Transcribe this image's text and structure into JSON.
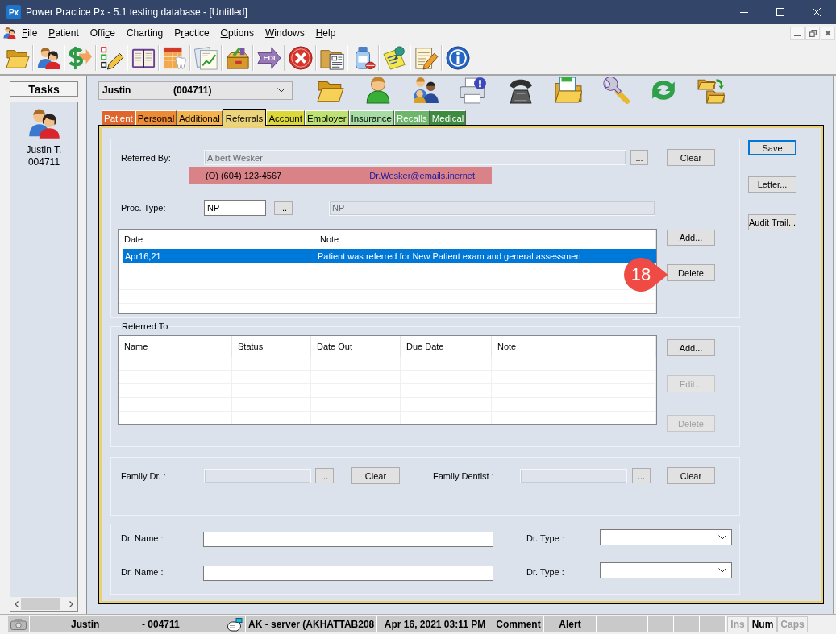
{
  "window": {
    "logo": "Px",
    "title": "Power Practice Px - 5.1 testing database - [Untitled]"
  },
  "menu": [
    {
      "key": "F",
      "rest": "ile"
    },
    {
      "key": "P",
      "rest": "atient"
    },
    {
      "lead": "Offi",
      "key": "c",
      "rest": "e"
    },
    {
      "lead": "Charting"
    },
    {
      "lead": "P",
      "key": "r",
      "rest": "actice"
    },
    {
      "key": "O",
      "rest": "ptions"
    },
    {
      "key": "W",
      "rest": "indows"
    },
    {
      "key": "H",
      "rest": "elp"
    }
  ],
  "toolbar": {
    "edi_label": "EDI"
  },
  "tasks": {
    "title": "Tasks",
    "patient_name": "Justin T.",
    "patient_id": "004711"
  },
  "patient_selector": {
    "name": "Justin",
    "id": "(004711)"
  },
  "tabs": [
    {
      "label": "Patient",
      "selected": false,
      "color": "#e0652d"
    },
    {
      "label": "Personal",
      "selected": false,
      "color": "#ec8a35"
    },
    {
      "label": "Additional",
      "selected": false,
      "color": "#f3b450"
    },
    {
      "label": "Referrals",
      "selected": true,
      "color": "#ecd47c"
    },
    {
      "label": "Account",
      "selected": false,
      "color": "#dcd83a"
    },
    {
      "label": "Employer",
      "selected": false,
      "color": "#bde172"
    },
    {
      "label": "Insurance",
      "selected": false,
      "color": "#a7dca5"
    },
    {
      "label": "Recalls",
      "selected": false,
      "color": "#6cb56a"
    },
    {
      "label": "Medical",
      "selected": false,
      "color": "#3d8b3f"
    }
  ],
  "referred_by": {
    "label": "Referred By:",
    "field": {
      "value": "Albert Wesker",
      "disabled": true
    },
    "browse": "...",
    "clear": "Clear",
    "phone": "(O) (604) 123-4567",
    "email": "Dr.Wesker@emails.inernet"
  },
  "proc_type": {
    "label": "Proc. Type:",
    "code": {
      "value": "NP",
      "disabled": false
    },
    "browse": "...",
    "description": {
      "value": "NP",
      "disabled": true
    }
  },
  "referral_notes": {
    "columns": [
      "Date",
      "Note"
    ],
    "rows": [
      {
        "cells": [
          "Apr16,21",
          "Patient was referred for New Patient exam and general assessmen"
        ],
        "selected": true
      }
    ],
    "buttons": [
      {
        "label": "Add...",
        "disabled": false
      },
      {
        "label": "Delete",
        "disabled": false
      }
    ]
  },
  "referred_to": {
    "title": "Referred To",
    "columns": [
      "Name",
      "Status",
      "Date Out",
      "Due Date",
      "Note"
    ],
    "buttons": [
      {
        "label": "Add...",
        "disabled": false
      },
      {
        "label": "Edit...",
        "disabled": true
      },
      {
        "label": "Delete",
        "disabled": true
      }
    ]
  },
  "family": [
    {
      "label": "Family Dr. :",
      "field": {
        "disabled": true
      },
      "browse": "...",
      "clear": "Clear"
    },
    {
      "label": "Family Dentist :",
      "field": {
        "disabled": true
      },
      "browse": "...",
      "clear": "Clear"
    }
  ],
  "doctors": [
    {
      "name_label": "Dr. Name :",
      "type_label": "Dr. Type :"
    },
    {
      "name_label": "Dr. Name :",
      "type_label": "Dr. Type :"
    }
  ],
  "actions": [
    {
      "label": "Save",
      "default": true
    },
    {
      "label": "Letter...",
      "default": false
    },
    {
      "label": "Audit Trail...",
      "default": false
    }
  ],
  "callout": {
    "number": "18"
  },
  "status_bar": {
    "patient_name": "Justin",
    "patient_id": "- 004711",
    "server": "AK - server (AKHATTAB208",
    "datetime": "Apr 16, 2021 03:11 PM",
    "comment": "Comment",
    "alert": "Alert",
    "keys": [
      {
        "label": "Ins",
        "on": false
      },
      {
        "label": "Num",
        "on": true
      },
      {
        "label": "Caps",
        "on": false
      }
    ]
  }
}
